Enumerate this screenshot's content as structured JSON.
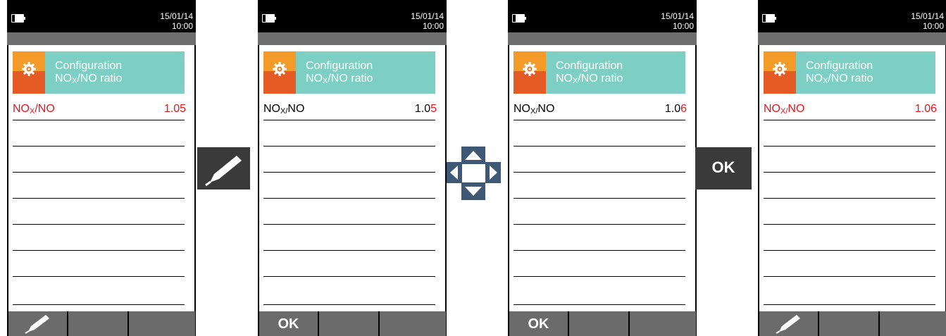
{
  "screens": [
    {
      "date": "15/01/14",
      "time": "10:00",
      "title_line1": "Configuration",
      "title_line2_pre": "NO",
      "title_line2_sub": "X",
      "title_line2_post": "/NO ratio",
      "row_label_pre": "NO",
      "row_label_sub": "X",
      "row_label_post": "/NO",
      "row_value_a": "1.05",
      "row_value_b": "",
      "softkeys": {
        "left": "",
        "middle": "",
        "right": ""
      }
    },
    {
      "date": "15/01/14",
      "time": "10:00",
      "title_line1": "Configuration",
      "title_line2_pre": "NO",
      "title_line2_sub": "X",
      "title_line2_post": "/NO ratio",
      "row_label_pre": "NO",
      "row_label_sub": "X/",
      "row_label_post": "NO",
      "row_value_a": "1.0",
      "row_value_b": "5",
      "softkeys": {
        "left": "OK",
        "middle": "",
        "right": ""
      }
    },
    {
      "date": "15/01/14",
      "time": "10:00",
      "title_line1": "Configuration",
      "title_line2_pre": "NO",
      "title_line2_sub": "X",
      "title_line2_post": "/NO ratio",
      "row_label_pre": "NO",
      "row_label_sub": "X/",
      "row_label_post": "NO",
      "row_value_a": "1.0",
      "row_value_b": "6",
      "softkeys": {
        "left": "OK",
        "middle": "",
        "right": ""
      }
    },
    {
      "date": "15/01/14",
      "time": "10:00",
      "title_line1": "Configuration",
      "title_line2_pre": "NO",
      "title_line2_sub": "X",
      "title_line2_post": "/NO ratio",
      "row_label_pre": "NO",
      "row_label_sub": "X/",
      "row_label_post": "NO",
      "row_value_a": "1.06",
      "row_value_b": "",
      "softkeys": {
        "left": "",
        "middle": "",
        "right": ""
      }
    }
  ],
  "actions": {
    "ok_label": "OK"
  },
  "icons": {
    "edit": "pen-icon",
    "nav": "arrow-keys-icon",
    "settings": "gear-icon",
    "battery": "battery-icon"
  },
  "colors": {
    "accent_red": "#e8141c",
    "header_teal": "#7dcfc4",
    "icon_orange": "#f39a28",
    "icon_red": "#e55b26"
  }
}
